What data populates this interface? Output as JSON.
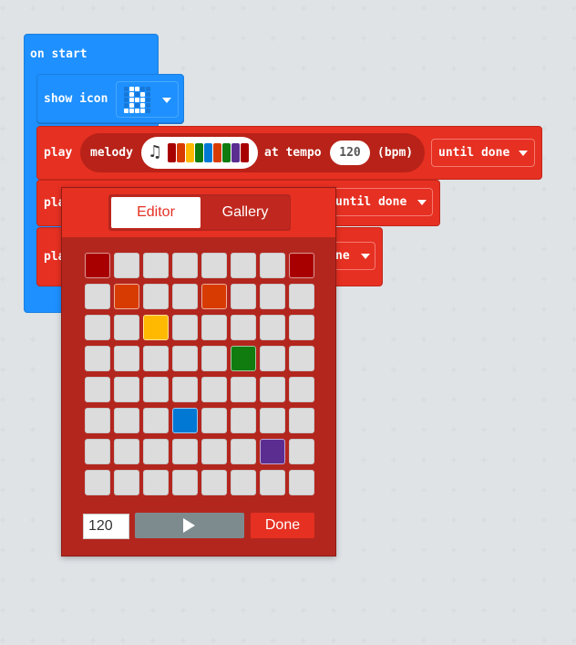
{
  "blocks": {
    "on_start": {
      "label": "on start"
    },
    "show_icon": {
      "label": "show icon"
    },
    "play1": {
      "play_label": "play",
      "melody_label": "melody",
      "at_tempo_label": "at tempo",
      "tempo_value": "120",
      "bpm_label": "(bpm)",
      "until_label": "until done"
    },
    "play2": {
      "play_label": "pla",
      "until_label": "until done"
    },
    "play3": {
      "play_label": "pla",
      "until_label": "ne"
    }
  },
  "melody_strip_colors": [
    "#a80000",
    "#d83b01",
    "#ffb900",
    "#107c10",
    "#0078d4",
    "#d83b01",
    "#107c10",
    "#5c2d91",
    "#a80000"
  ],
  "popup": {
    "tabs": {
      "editor": "Editor",
      "gallery": "Gallery"
    },
    "tempo_input": "120",
    "done_label": "Done",
    "note_grid": {
      "columns": 8,
      "rows": 8,
      "active": [
        {
          "row": 0,
          "col": 0,
          "color": "#a80000"
        },
        {
          "row": 0,
          "col": 7,
          "color": "#a80000"
        },
        {
          "row": 1,
          "col": 1,
          "color": "#d83b01"
        },
        {
          "row": 1,
          "col": 4,
          "color": "#d83b01"
        },
        {
          "row": 2,
          "col": 2,
          "color": "#ffb900"
        },
        {
          "row": 3,
          "col": 5,
          "color": "#107c10"
        },
        {
          "row": 5,
          "col": 3,
          "color": "#0078d4"
        },
        {
          "row": 6,
          "col": 6,
          "color": "#5c2d91"
        }
      ]
    }
  },
  "icon_pattern": [
    [
      0,
      1,
      1,
      0,
      0
    ],
    [
      0,
      1,
      0,
      1,
      0
    ],
    [
      0,
      1,
      1,
      1,
      0
    ],
    [
      0,
      1,
      0,
      1,
      0
    ],
    [
      1,
      1,
      1,
      1,
      0
    ]
  ],
  "icons": {
    "dropdown": "chevron-down-icon",
    "melody": "music-note-icon",
    "play": "play-icon"
  }
}
